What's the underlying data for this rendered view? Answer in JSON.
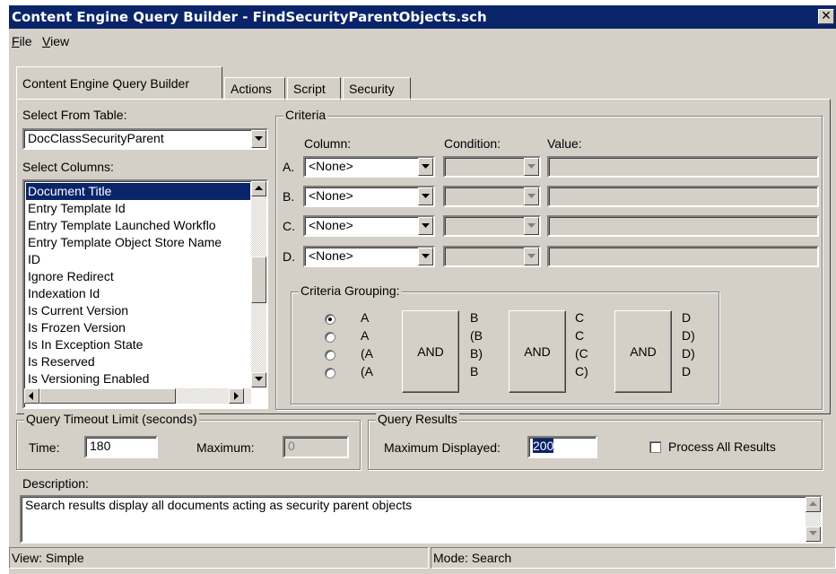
{
  "window": {
    "title": "Content Engine Query Builder - FindSecurityParentObjects.sch",
    "close_glyph": "✕"
  },
  "menu": [
    "File",
    "View"
  ],
  "tabs": [
    "Content Engine Query Builder",
    "Actions",
    "Script",
    "Security"
  ],
  "select_from": {
    "label": "Select From Table:",
    "value": "DocClassSecurityParent"
  },
  "select_columns": {
    "label": "Select Columns:",
    "items": [
      "Document Title",
      "Entry Template Id",
      "Entry Template Launched Workflo",
      "Entry Template Object Store Name",
      "ID",
      "Ignore Redirect",
      "Indexation Id",
      "Is Current Version",
      "Is Frozen Version",
      "Is In Exception State",
      "Is Reserved",
      "Is Versioning Enabled"
    ],
    "selected_index": 0
  },
  "criteria": {
    "title": "Criteria",
    "column_header": "Column:",
    "condition_header": "Condition:",
    "value_header": "Value:",
    "rows": [
      {
        "letter": "A.",
        "column": "<None>",
        "condition": "",
        "value": ""
      },
      {
        "letter": "B.",
        "column": "<None>",
        "condition": "",
        "value": ""
      },
      {
        "letter": "C.",
        "column": "<None>",
        "condition": "",
        "value": ""
      },
      {
        "letter": "D.",
        "column": "<None>",
        "condition": "",
        "value": ""
      }
    ]
  },
  "grouping": {
    "title": "Criteria Grouping:",
    "options": [
      {
        "c1": "A",
        "c2": "B",
        "c3": "C",
        "c4": "D",
        "checked": true
      },
      {
        "c1": "A",
        "c2": "(B",
        "c3": "C",
        "c4": "D)",
        "checked": false
      },
      {
        "c1": "(A",
        "c2": "B)",
        "c3": "(C",
        "c4": "D)",
        "checked": false
      },
      {
        "c1": "(A",
        "c2": "B",
        "c3": "C)",
        "c4": "D",
        "checked": false
      }
    ],
    "and_labels": [
      "AND",
      "AND",
      "AND"
    ]
  },
  "timeout": {
    "title": "Query Timeout Limit (seconds)",
    "time_label": "Time:",
    "time_value": "180",
    "max_label": "Maximum:",
    "max_value": "0"
  },
  "results": {
    "title": "Query Results",
    "max_label": "Maximum Displayed:",
    "max_value": "200",
    "process_all_label": "Process All Results",
    "process_all_checked": false
  },
  "description": {
    "label": "Description:",
    "text": "Search results display all documents acting as security parent objects"
  },
  "status": {
    "view": "View: Simple",
    "mode": "Mode: Search"
  }
}
